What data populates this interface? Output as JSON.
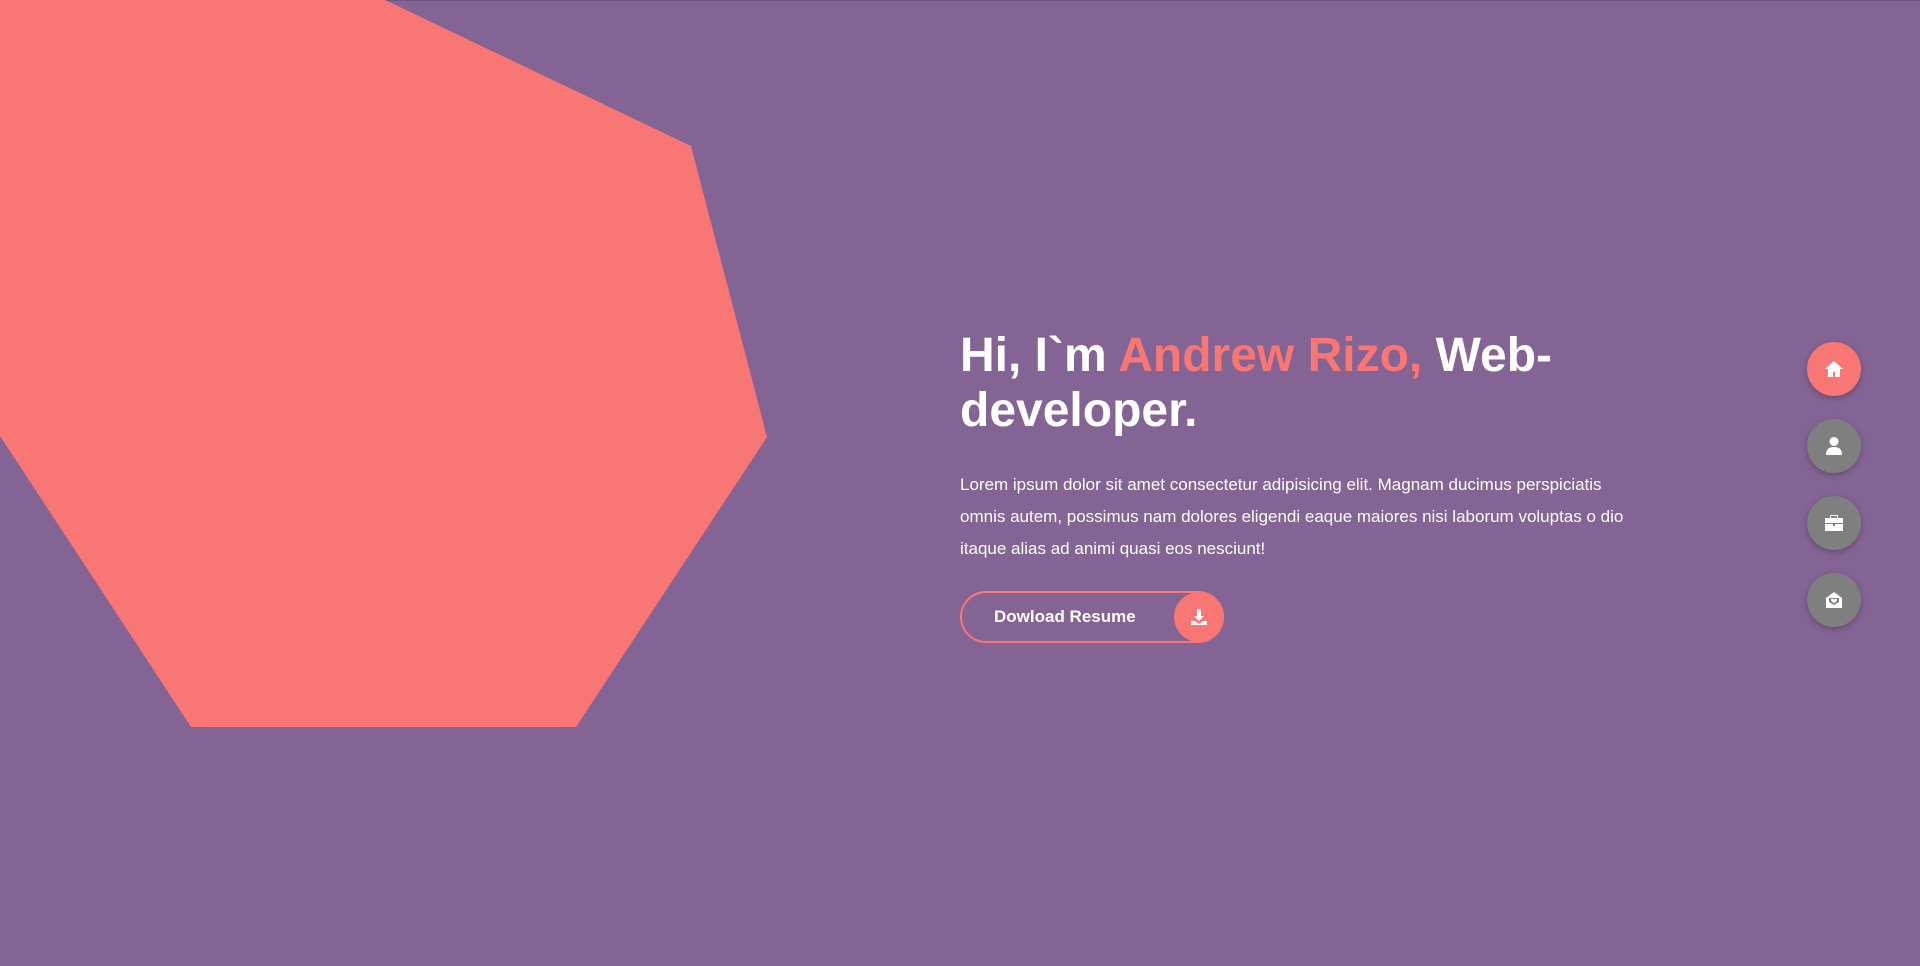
{
  "colors": {
    "background": "#836494",
    "accent": "#f87674",
    "nav_inactive": "#7f7f7f",
    "text": "#ffffff"
  },
  "hero": {
    "greeting": "Hi, I`m ",
    "name": "Andrew Rizo,",
    "role": " Web-developer.",
    "description": "Lorem ipsum dolor sit amet consectetur adipisicing elit. Magnam ducimus perspiciatis omnis autem, possimus nam dolores eligendi eaque maiores nisi laborum voluptas o dio itaque alias ad animi quasi eos nesciunt!",
    "button_label": "Dowload Resume",
    "button_icon": "download-icon"
  },
  "nav": {
    "items": [
      {
        "icon": "home-icon",
        "active": true
      },
      {
        "icon": "user-icon",
        "active": false
      },
      {
        "icon": "briefcase-icon",
        "active": false
      },
      {
        "icon": "mail-icon",
        "active": false
      }
    ]
  }
}
